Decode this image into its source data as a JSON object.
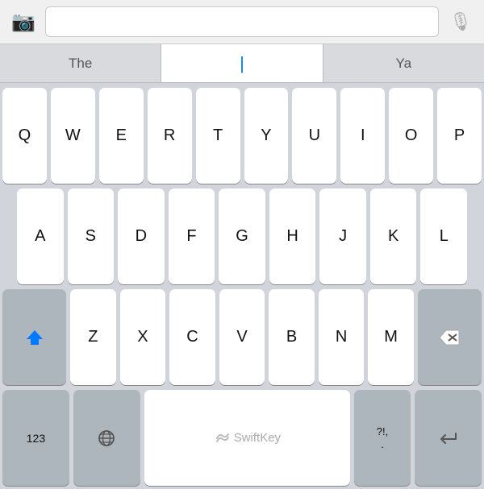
{
  "topbar": {
    "camera_label": "📷",
    "mic_label": "🎙",
    "input_placeholder": "",
    "input_value": ""
  },
  "suggestions": {
    "left": "The",
    "middle": "|",
    "right": "Ya"
  },
  "keyboard": {
    "row1": [
      "Q",
      "W",
      "E",
      "R",
      "T",
      "Y",
      "U",
      "I",
      "O",
      "P"
    ],
    "row2": [
      "A",
      "S",
      "D",
      "F",
      "G",
      "H",
      "J",
      "K",
      "L"
    ],
    "row3": [
      "Z",
      "X",
      "C",
      "V",
      "B",
      "N",
      "M"
    ],
    "row4_numbers": "123",
    "row4_space": "SwiftKey",
    "row4_punctuation_top": "?!,",
    "row4_punctuation_bottom": ".",
    "return_label": "↵"
  }
}
